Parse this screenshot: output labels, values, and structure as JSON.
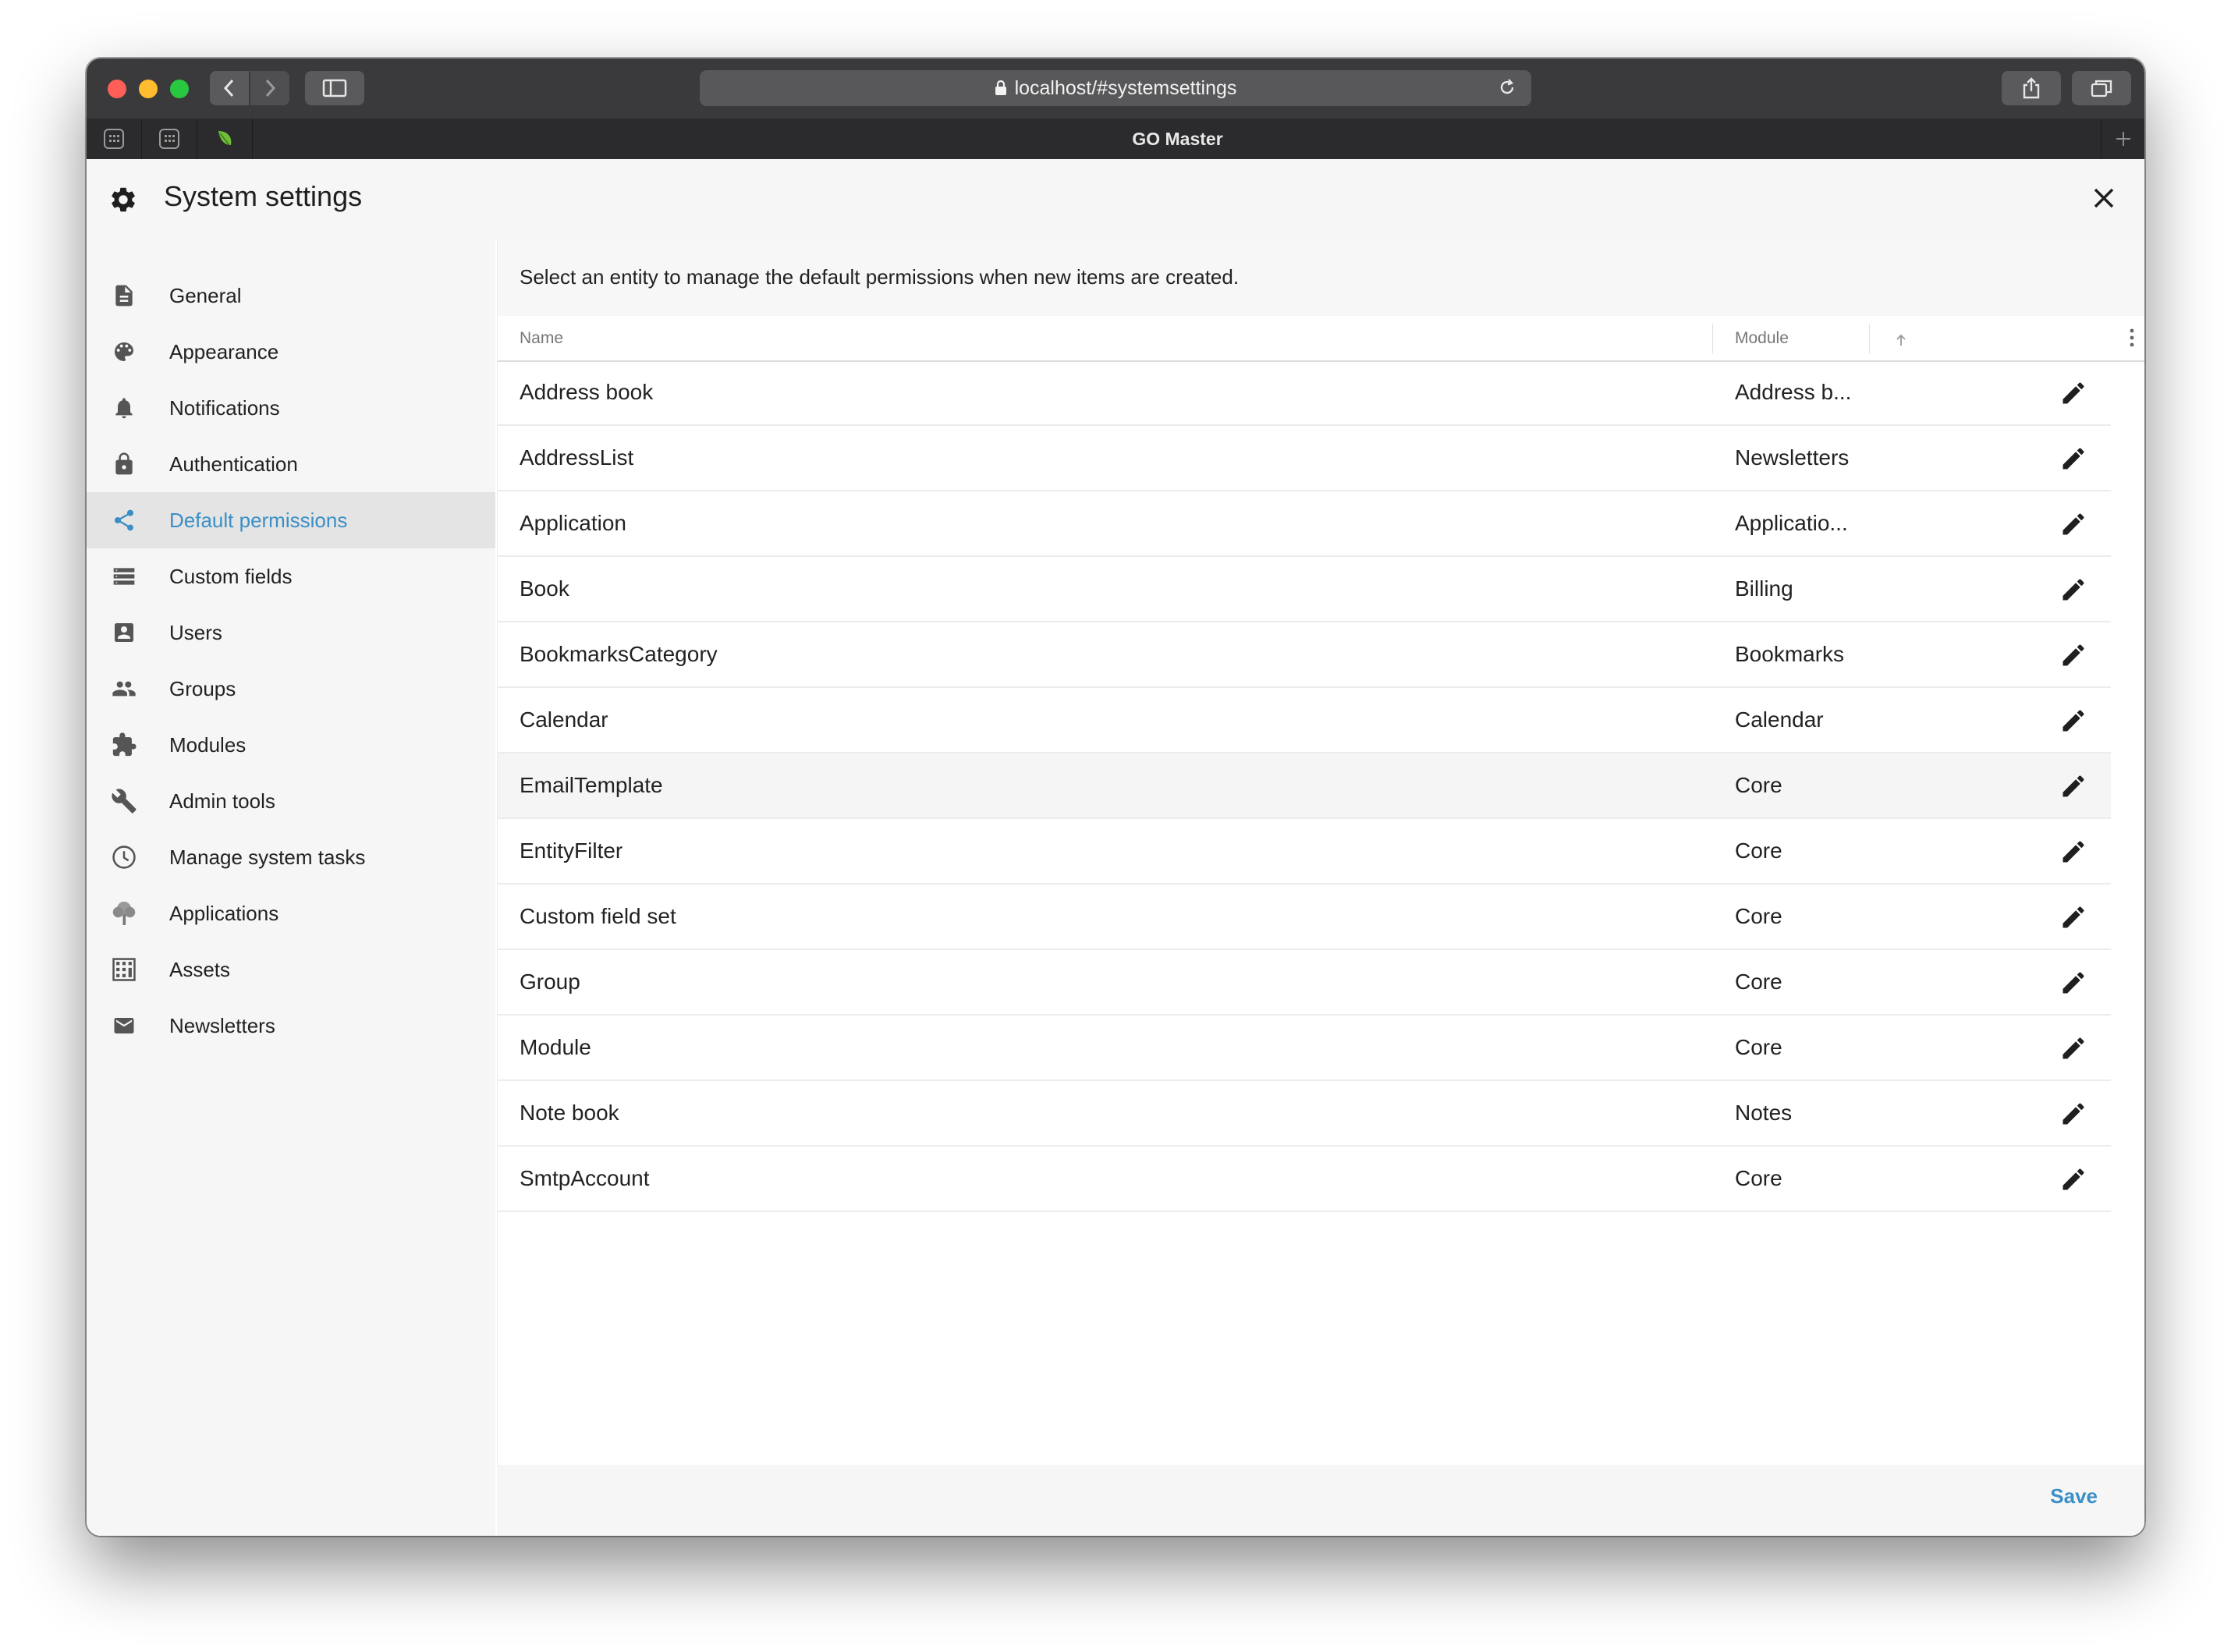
{
  "browser": {
    "url": "localhost/#systemsettings",
    "tab_title": "GO Master"
  },
  "app": {
    "title": "System settings"
  },
  "sidebar": {
    "items": [
      {
        "label": "General",
        "icon": "document-icon"
      },
      {
        "label": "Appearance",
        "icon": "palette-icon"
      },
      {
        "label": "Notifications",
        "icon": "bell-icon"
      },
      {
        "label": "Authentication",
        "icon": "lock-icon"
      },
      {
        "label": "Default permissions",
        "icon": "share-icon",
        "active": true
      },
      {
        "label": "Custom fields",
        "icon": "list-icon"
      },
      {
        "label": "Users",
        "icon": "user-icon"
      },
      {
        "label": "Groups",
        "icon": "group-icon"
      },
      {
        "label": "Modules",
        "icon": "puzzle-icon"
      },
      {
        "label": "Admin tools",
        "icon": "wrench-icon"
      },
      {
        "label": "Manage system tasks",
        "icon": "clock-icon"
      },
      {
        "label": "Applications",
        "icon": "tree-icon"
      },
      {
        "label": "Assets",
        "icon": "assets-icon"
      },
      {
        "label": "Newsletters",
        "icon": "mail-icon"
      }
    ]
  },
  "main": {
    "intro": "Select an entity to manage the default permissions when new items are created.",
    "columns": {
      "name": "Name",
      "module": "Module"
    },
    "rows": [
      {
        "name": "Address book",
        "module": "Address b..."
      },
      {
        "name": "AddressList",
        "module": "Newsletters"
      },
      {
        "name": "Application",
        "module": "Applicatio..."
      },
      {
        "name": "Book",
        "module": "Billing"
      },
      {
        "name": "BookmarksCategory",
        "module": "Bookmarks"
      },
      {
        "name": "Calendar",
        "module": "Calendar"
      },
      {
        "name": "EmailTemplate",
        "module": "Core"
      },
      {
        "name": "EntityFilter",
        "module": "Core"
      },
      {
        "name": "Custom field set",
        "module": "Core"
      },
      {
        "name": "Group",
        "module": "Core"
      },
      {
        "name": "Module",
        "module": "Core"
      },
      {
        "name": "Note book",
        "module": "Notes"
      },
      {
        "name": "SmtpAccount",
        "module": "Core"
      }
    ]
  },
  "footer": {
    "save_label": "Save"
  },
  "colors": {
    "accent": "#3a8fc6",
    "titlebar": "#3a3a3c"
  }
}
